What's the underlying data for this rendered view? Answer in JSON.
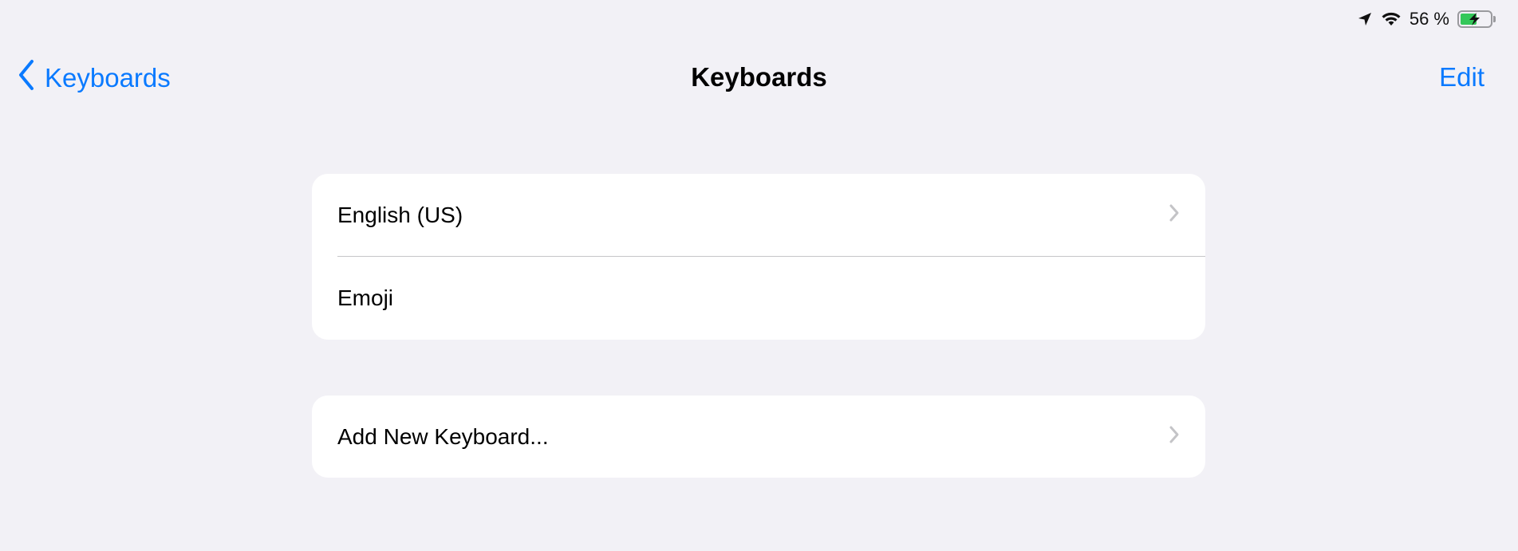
{
  "status_bar": {
    "location_icon": "location-arrow-icon",
    "wifi_icon": "wifi-icon",
    "battery_percent_label": "56 %",
    "battery_level": 0.56,
    "battery_charging": true,
    "battery_fill_color": "#34c759"
  },
  "nav": {
    "back_label": "Keyboards",
    "title": "Keyboards",
    "edit_label": "Edit",
    "accent_color": "#0a7aff"
  },
  "keyboards_list": {
    "items": [
      {
        "label": "English (US)",
        "has_chevron": true
      },
      {
        "label": "Emoji",
        "has_chevron": false
      }
    ]
  },
  "add_group": {
    "label": "Add New Keyboard..."
  }
}
